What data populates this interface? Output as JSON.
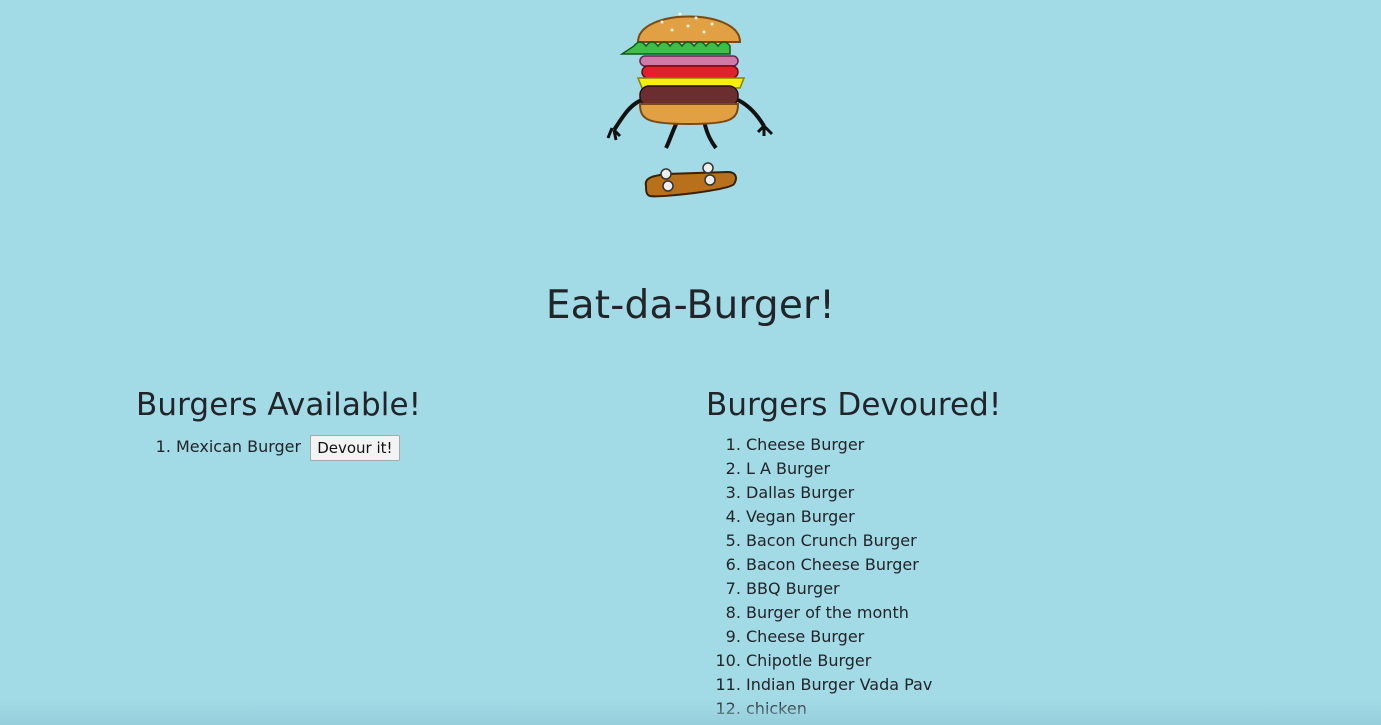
{
  "header": {
    "title": "Eat-da-Burger!"
  },
  "mascot": {
    "icon": "skateboarding-burger-icon"
  },
  "available": {
    "heading": "Burgers Available!",
    "items": [
      {
        "name": "Mexican Burger",
        "button_label": "Devour it!"
      }
    ]
  },
  "devoured": {
    "heading": "Burgers Devoured!",
    "items": [
      "Cheese Burger",
      "L A Burger",
      "Dallas Burger",
      "Vegan Burger",
      "Bacon Crunch Burger",
      "Bacon Cheese Burger",
      "BBQ Burger",
      "Burger of the month",
      "Cheese Burger",
      "Chipotle Burger",
      "Indian Burger Vada Pav",
      "chicken"
    ]
  },
  "colors": {
    "background": "#a2dae6",
    "text": "#212529"
  }
}
